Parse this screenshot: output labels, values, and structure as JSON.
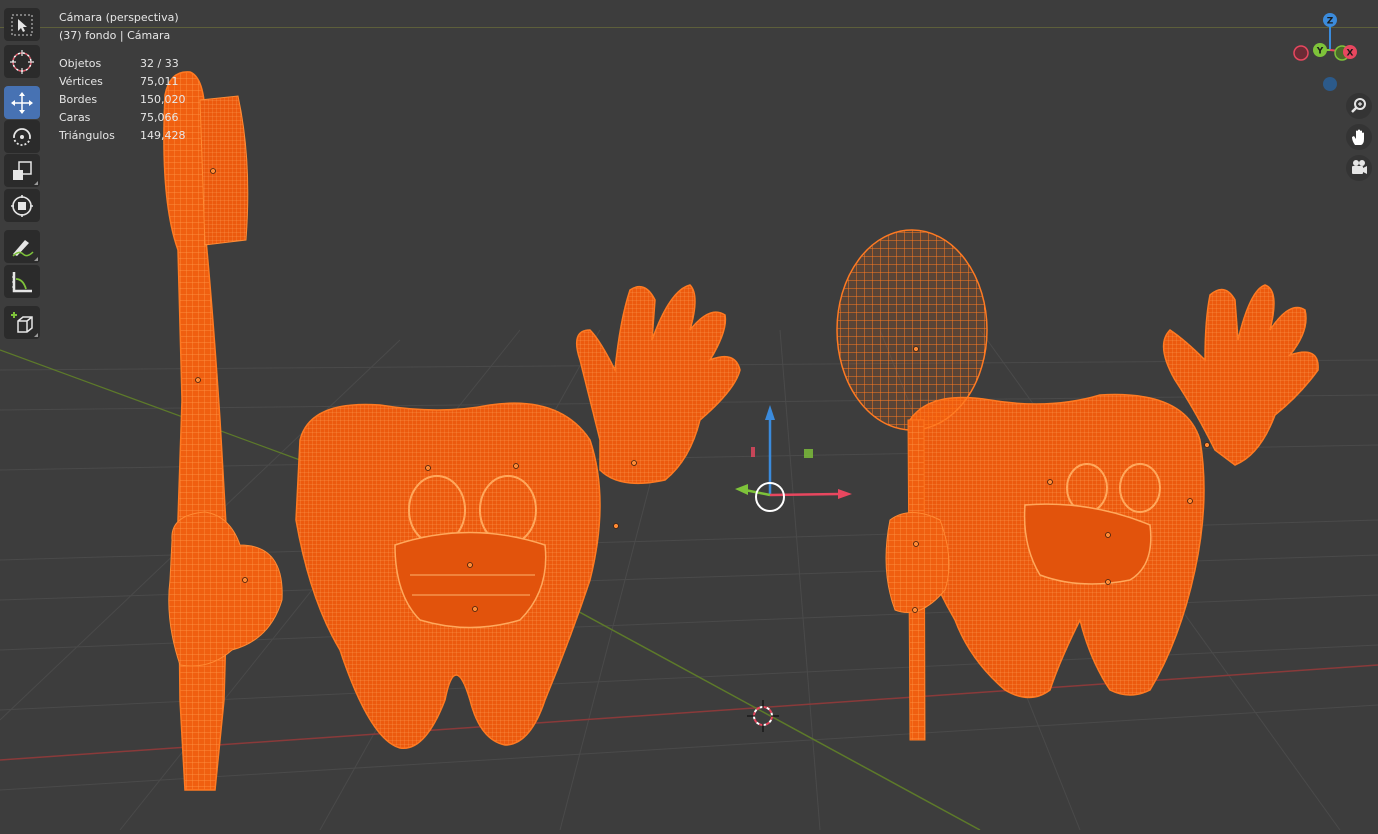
{
  "viewport": {
    "title": "Cámara (perspectiva)",
    "subtitle": "(37) fondo | Cámara"
  },
  "stats": [
    {
      "label": "Objetos",
      "value": "32 / 33"
    },
    {
      "label": "Vértices",
      "value": "75,011"
    },
    {
      "label": "Bordes",
      "value": "150,020"
    },
    {
      "label": "Caras",
      "value": "75,066"
    },
    {
      "label": "Triángulos",
      "value": "149,428"
    }
  ],
  "toolbar": {
    "tools": [
      {
        "name": "select-box",
        "icon": "cursor-arrow-icon",
        "active": false
      },
      {
        "name": "cursor",
        "icon": "crosshair-cursor-icon",
        "active": false
      },
      {
        "name": "move",
        "icon": "move-arrows-icon",
        "active": true
      },
      {
        "name": "rotate",
        "icon": "rotate-icon",
        "active": false
      },
      {
        "name": "scale",
        "icon": "scale-icon",
        "active": false
      },
      {
        "name": "transform",
        "icon": "transform-icon",
        "active": false
      },
      {
        "name": "annotate",
        "icon": "pencil-icon",
        "active": false
      },
      {
        "name": "measure",
        "icon": "ruler-icon",
        "active": false
      },
      {
        "name": "add-cube",
        "icon": "add-cube-icon",
        "active": false
      }
    ]
  },
  "gizmo": {
    "z_label": "Z",
    "y_label": "Y",
    "x_label": "X",
    "colors": {
      "x": "#e8475f",
      "y": "#7ec33a",
      "z": "#3b8bdc"
    }
  },
  "navigation": [
    {
      "name": "zoom",
      "icon": "magnifier-icon"
    },
    {
      "name": "pan",
      "icon": "hand-icon"
    },
    {
      "name": "camera-view",
      "icon": "camera-icon"
    }
  ],
  "colors": {
    "background": "#3d3d3d",
    "wireframe": "#ff6a10",
    "accent": "#4772b3"
  }
}
